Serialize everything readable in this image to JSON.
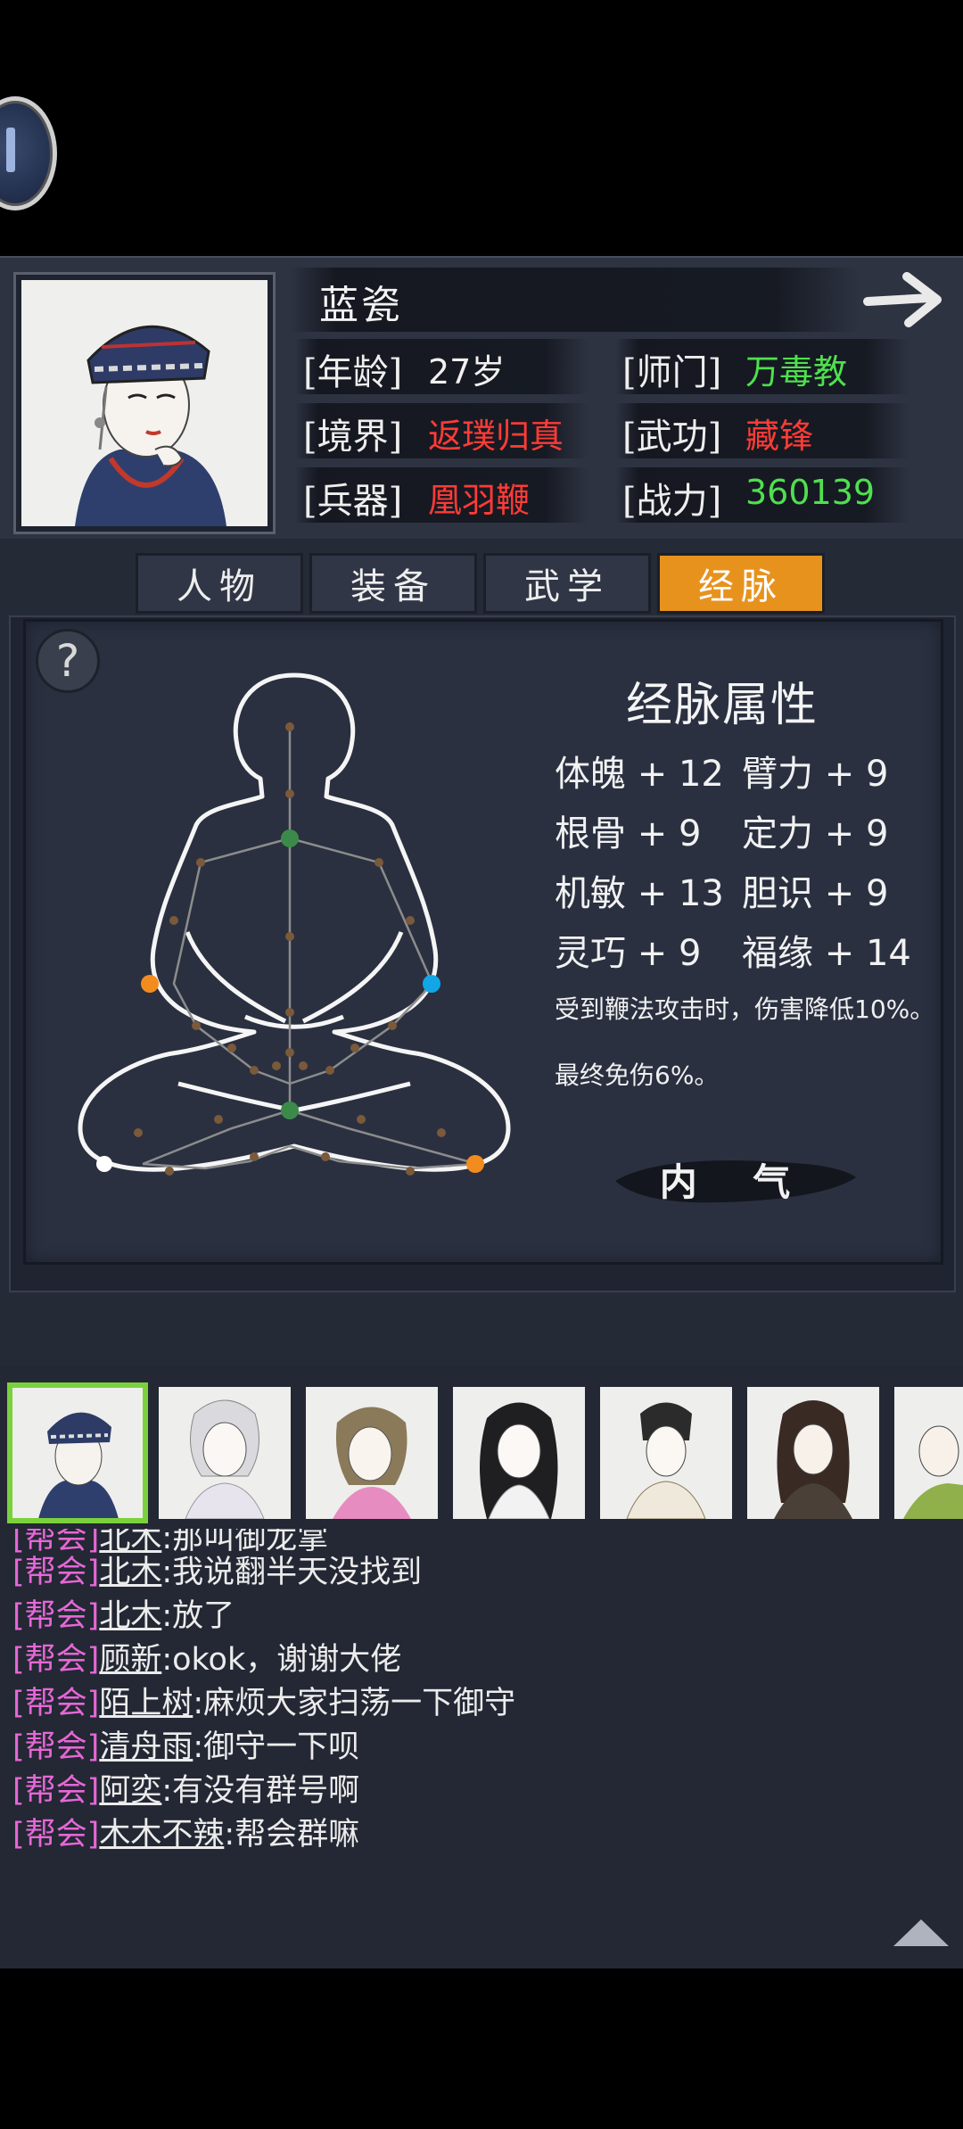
{
  "character": {
    "name": "蓝瓷",
    "stats": [
      {
        "label": "[年龄]",
        "value": "27岁",
        "color": "#f0f0f0"
      },
      {
        "label": "[师门]",
        "value": "万毒教",
        "color": "#4fe04f"
      },
      {
        "label": "[境界]",
        "value": "返璞归真",
        "color": "#ff3b36"
      },
      {
        "label": "[武功]",
        "value": "藏锋",
        "color": "#ff3b36"
      },
      {
        "label": "[兵器]",
        "value": "凰羽鞭",
        "color": "#ff3b36"
      },
      {
        "label": "[战力]",
        "value": "360139",
        "color": "#4fe04f"
      }
    ]
  },
  "tabs": [
    {
      "label": "人物",
      "active": false
    },
    {
      "label": "装备",
      "active": false
    },
    {
      "label": "武学",
      "active": false
    },
    {
      "label": "经脉",
      "active": true
    }
  ],
  "meridian": {
    "title": "经脉属性",
    "attributes": [
      {
        "text": "体魄 + 12"
      },
      {
        "text": "臂力 + 9"
      },
      {
        "text": "根骨 + 9"
      },
      {
        "text": "定力 + 9"
      },
      {
        "text": "机敏 + 13"
      },
      {
        "text": "胆识 + 9"
      },
      {
        "text": "灵巧 + 9"
      },
      {
        "text": "福缘 + 14"
      }
    ],
    "effects": [
      "受到鞭法攻击时，伤害降低10%。",
      "最终免伤6%。"
    ],
    "neiqi_button": "内 气",
    "help_icon": "?"
  },
  "chat": [
    {
      "tag": "[帮会]",
      "user": "北木",
      "msg": ":那叫御龙掌"
    },
    {
      "tag": "[帮会]",
      "user": "北木",
      "msg": ":我说翻半天没找到"
    },
    {
      "tag": "[帮会]",
      "user": "北木",
      "msg": ":放了"
    },
    {
      "tag": "[帮会]",
      "user": "顾新",
      "msg": ":okok，谢谢大佬"
    },
    {
      "tag": "[帮会]",
      "user": "陌上树",
      "msg": ":麻烦大家扫荡一下御守"
    },
    {
      "tag": "[帮会]",
      "user": "清舟雨",
      "msg": ":御守一下呗"
    },
    {
      "tag": "[帮会]",
      "user": "阿奕",
      "msg": ":有没有群号啊"
    },
    {
      "tag": "[帮会]",
      "user": "木木不辣",
      "msg": ":帮会群嘛"
    }
  ],
  "colors": {
    "accent_tab": "#e8921e",
    "chat_tag": "#e667d6",
    "selected_border": "#7bd13c"
  }
}
